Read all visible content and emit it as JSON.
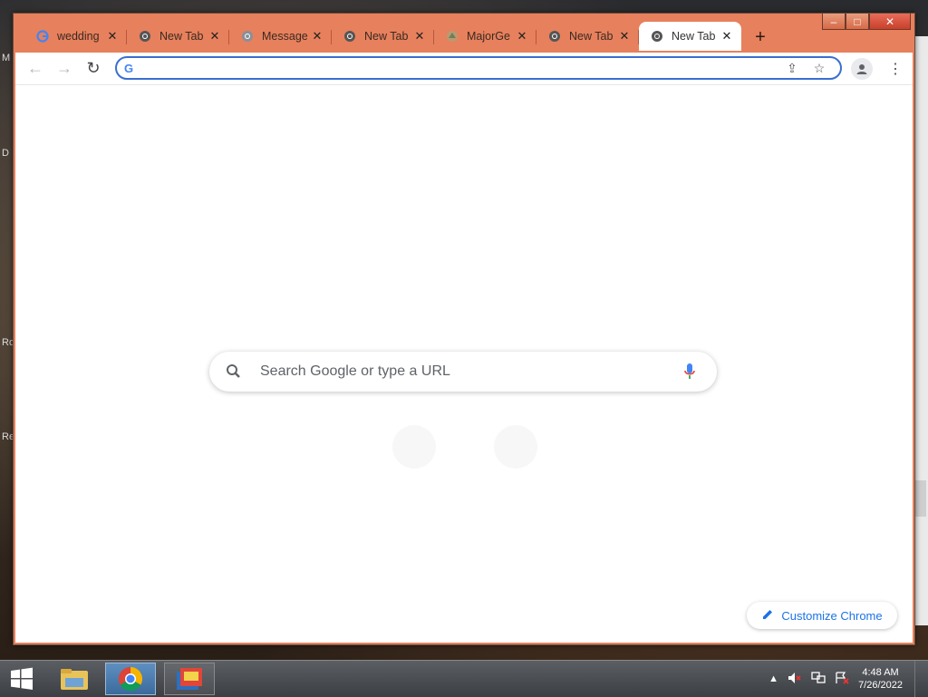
{
  "desktop": {
    "edge_labels": [
      "M",
      "D",
      "Ro",
      "Re"
    ]
  },
  "window": {
    "controls": {
      "minimize": "–",
      "maximize": "□",
      "close": "✕"
    }
  },
  "tabs": [
    {
      "title": "wedding",
      "icon": "google-icon",
      "active": false
    },
    {
      "title": "New Tab",
      "icon": "chrome-icon",
      "active": false
    },
    {
      "title": "Message",
      "icon": "chrome-icon",
      "active": false
    },
    {
      "title": "New Tab",
      "icon": "chrome-icon",
      "active": false
    },
    {
      "title": "MajorGe",
      "icon": "site-icon",
      "active": false
    },
    {
      "title": "New Tab",
      "icon": "chrome-icon",
      "active": false
    },
    {
      "title": "New Tab",
      "icon": "chrome-icon",
      "active": true
    }
  ],
  "tab_close": "✕",
  "new_tab": "+",
  "toolbar": {
    "back": "←",
    "forward": "→",
    "reload": "↻",
    "omnibox_value": "",
    "omnibox_g": "G",
    "share": "⇪",
    "bookmark": "☆",
    "menu": "⋮"
  },
  "ntp": {
    "search_placeholder": "Search Google or type a URL",
    "customize_label": "Customize Chrome"
  },
  "taskbar": {
    "apps": [
      {
        "name": "file-explorer"
      },
      {
        "name": "chrome",
        "active": true
      },
      {
        "name": "app"
      }
    ],
    "tray_arrow": "▲",
    "time": "4:48 AM",
    "date": "7/26/2022"
  },
  "colors": {
    "frame": "#e7805c",
    "accent_blue": "#1a73e8",
    "omnibox_border": "#3a6fd1"
  }
}
